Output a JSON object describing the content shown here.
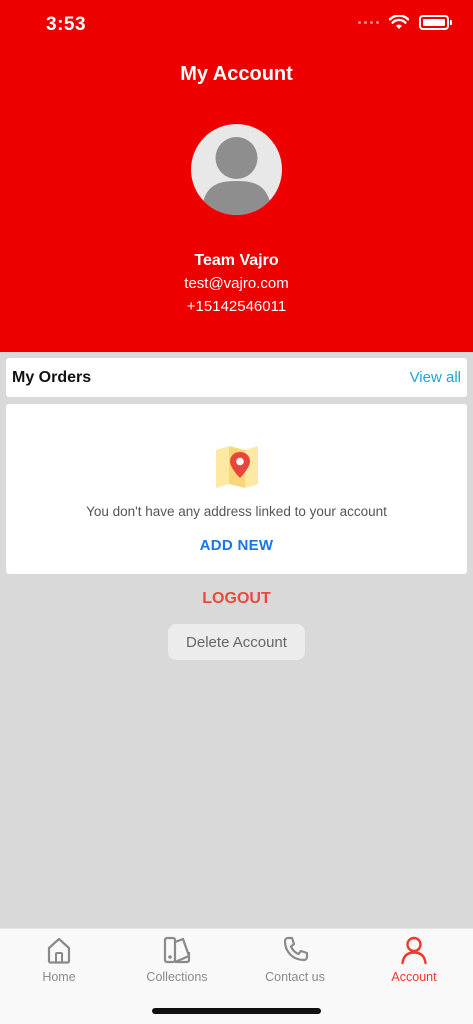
{
  "status_bar": {
    "time": "3:53"
  },
  "header": {
    "title": "My Account",
    "user": {
      "name": "Team Vajro",
      "email": "test@vajro.com",
      "phone": "+15142546011"
    }
  },
  "orders": {
    "title": "My Orders",
    "view_all_label": "View all"
  },
  "address": {
    "empty_message": "You don't have any address linked to your account",
    "add_new_label": "ADD NEW"
  },
  "actions": {
    "logout_label": "LOGOUT",
    "delete_account_label": "Delete Account"
  },
  "tabbar": {
    "tabs": [
      {
        "label": "Home",
        "icon": "home-icon",
        "active": false
      },
      {
        "label": "Collections",
        "icon": "collections-icon",
        "active": false
      },
      {
        "label": "Contact us",
        "icon": "phone-icon",
        "active": false
      },
      {
        "label": "Account",
        "icon": "person-icon",
        "active": true
      }
    ]
  },
  "colors": {
    "header_bg": "#ee0000",
    "accent_red": "#ee3a2c",
    "link_blue": "#1976e8",
    "view_all_blue": "#1fa3d6"
  }
}
